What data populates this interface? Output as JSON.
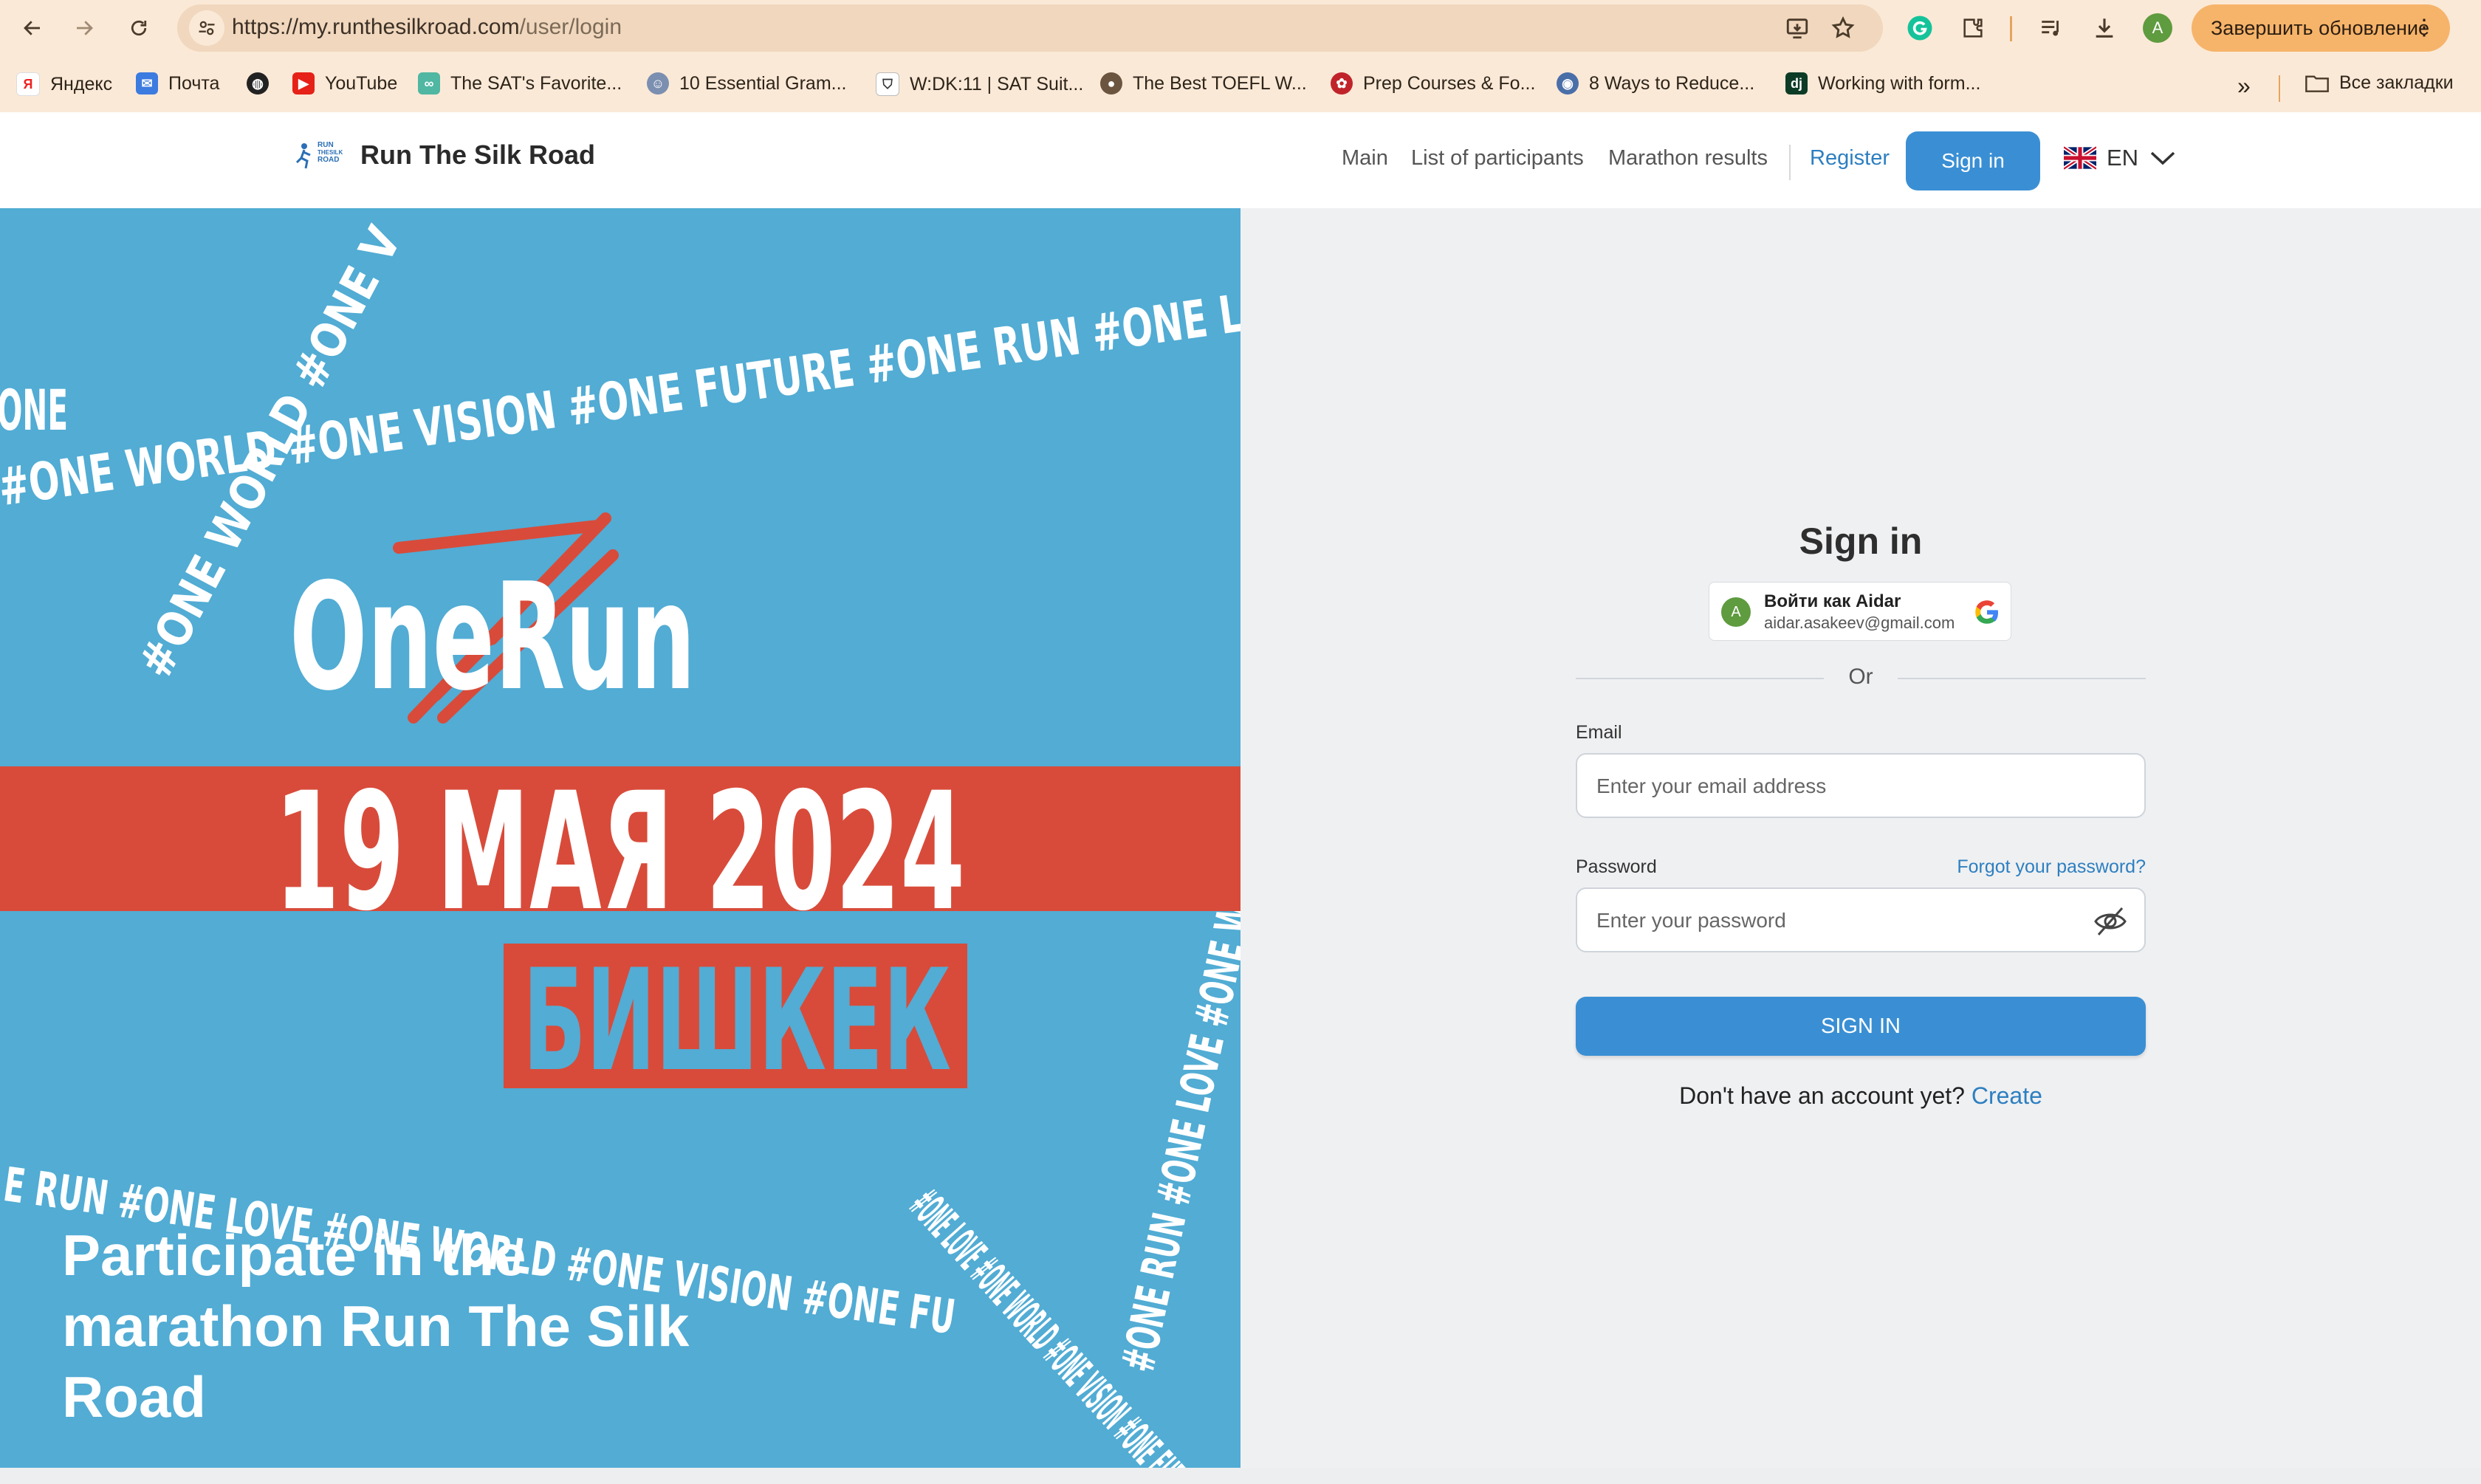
{
  "browser": {
    "url_host": "https://my.runthesilkroad.com",
    "url_path": "/user/login",
    "profile_initial": "A",
    "update_label": "Завершить обновление",
    "bookmarks": [
      {
        "label": "Яндекс",
        "icon": "yandex-icon"
      },
      {
        "label": "Почта",
        "icon": "mail-icon"
      },
      {
        "label": "",
        "icon": "globe-icon"
      },
      {
        "label": "YouTube",
        "icon": "youtube-icon"
      },
      {
        "label": "The SAT's Favorite...",
        "icon": "link-icon"
      },
      {
        "label": "10 Essential Gram...",
        "icon": "link-icon"
      },
      {
        "label": "W:DK:11 | SAT Suit...",
        "icon": "shield-icon"
      },
      {
        "label": "The Best TOEFL W...",
        "icon": "link-icon"
      },
      {
        "label": "Prep Courses & Fo...",
        "icon": "link-icon"
      },
      {
        "label": "8 Ways to Reduce...",
        "icon": "link-icon"
      },
      {
        "label": "Working with form...",
        "icon": "django-icon"
      }
    ],
    "all_bookmarks_label": "Все закладки",
    "more_bookmarks": "»"
  },
  "header": {
    "logo_text": "Run The Silk Road",
    "logo_mark_text": [
      "RUN",
      "THE",
      "SILK",
      "ROAD"
    ],
    "nav": [
      "Main",
      "List of participants",
      "Marathon results"
    ],
    "register_label": "Register",
    "signin_label": "Sign in",
    "lang": "EN"
  },
  "hero": {
    "text": "Participate in the marathon Run The Silk Road",
    "poster": {
      "event_name": "OneRun",
      "date": "19 МАЯ 2024",
      "city": "БИШКЕК",
      "tagline_1": "#ONE WORLD #ONE VISION #ONE FUTURE #ONE RUN #ONE L",
      "tagline_2": "#ONE WORLD #ONE V",
      "tagline_3": "#ONE RUN #ONE LOVE #ONE WORLD",
      "tagline_4": "E RUN #ONE LOVE #ONE WORLD #ONE VISION #ONE FU",
      "tagline_5": "#ONE LOVE #ONE WORLD #ONE VISION #ONE FUTURE",
      "tagline_6": "ONE"
    }
  },
  "signin": {
    "title": "Sign in",
    "google_name": "Войти как Aidar",
    "google_email": "aidar.asakeev@gmail.com",
    "google_initial": "A",
    "or_label": "Or",
    "email_label": "Email",
    "email_placeholder": "Enter your email address",
    "password_label": "Password",
    "password_placeholder": "Enter your password",
    "forgot_label": "Forgot your password?",
    "submit_label": "SIGN IN",
    "no_account_text": "Don't have an account yet?",
    "create_label": "Create"
  },
  "colors": {
    "hero_blue": "#52acd4",
    "poster_red": "#d84b3a",
    "accent_blue": "#3a8fd4",
    "link_blue": "#2d7fc0"
  }
}
